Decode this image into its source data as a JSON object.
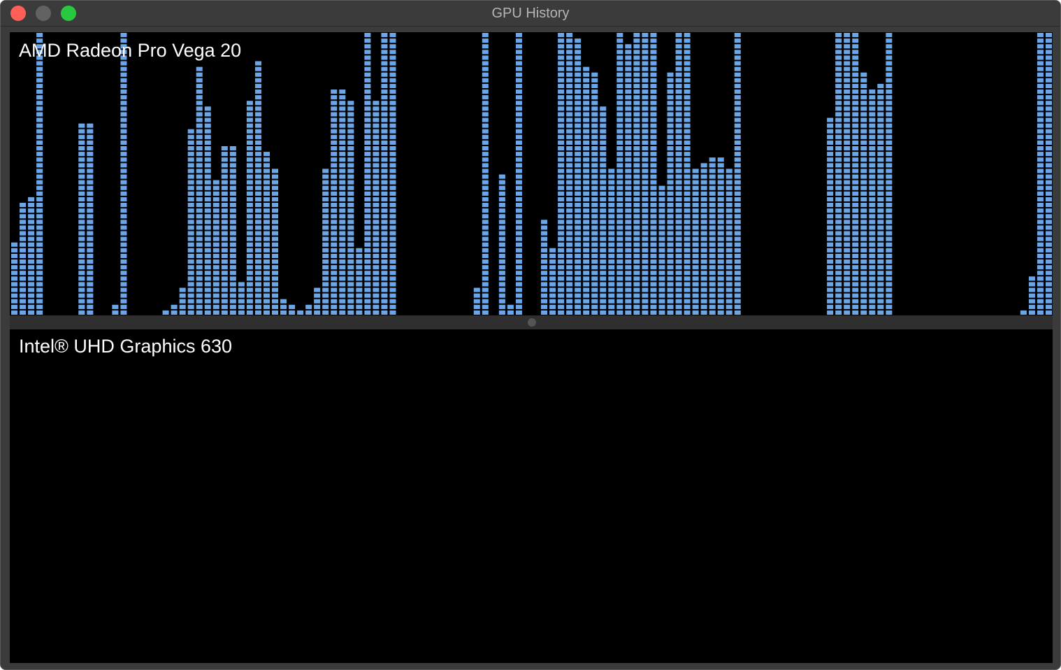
{
  "window": {
    "title": "GPU History",
    "accent_color": "#6aa6e8"
  },
  "panes": [
    {
      "gpu_name": "AMD Radeon Pro Vega 20",
      "history_columns": 124,
      "history_levels": 50,
      "history": [
        13,
        20,
        21,
        53,
        0,
        0,
        0,
        0,
        34,
        34,
        0,
        0,
        2,
        53,
        0,
        0,
        0,
        0,
        1,
        2,
        5,
        33,
        44,
        37,
        24,
        30,
        30,
        6,
        38,
        45,
        29,
        26,
        3,
        2,
        1,
        2,
        5,
        26,
        40,
        40,
        38,
        12,
        53,
        38,
        53,
        53,
        0,
        0,
        0,
        0,
        0,
        0,
        0,
        0,
        0,
        5,
        53,
        0,
        25,
        2,
        53,
        0,
        0,
        17,
        12,
        53,
        53,
        49,
        44,
        43,
        37,
        26,
        53,
        48,
        53,
        53,
        53,
        23,
        43,
        53,
        53,
        26,
        27,
        28,
        28,
        26,
        53,
        0,
        0,
        0,
        0,
        0,
        0,
        0,
        0,
        0,
        0,
        35,
        53,
        53,
        53,
        43,
        40,
        41,
        53,
        0,
        0,
        0,
        0,
        0,
        0,
        0,
        0,
        0,
        0,
        0,
        0,
        0,
        0,
        0,
        1,
        7,
        53,
        53,
        0,
        0,
        0,
        0
      ]
    },
    {
      "gpu_name": "Intel® UHD Graphics 630",
      "history_columns": 124,
      "history_levels": 50,
      "history": []
    }
  ]
}
